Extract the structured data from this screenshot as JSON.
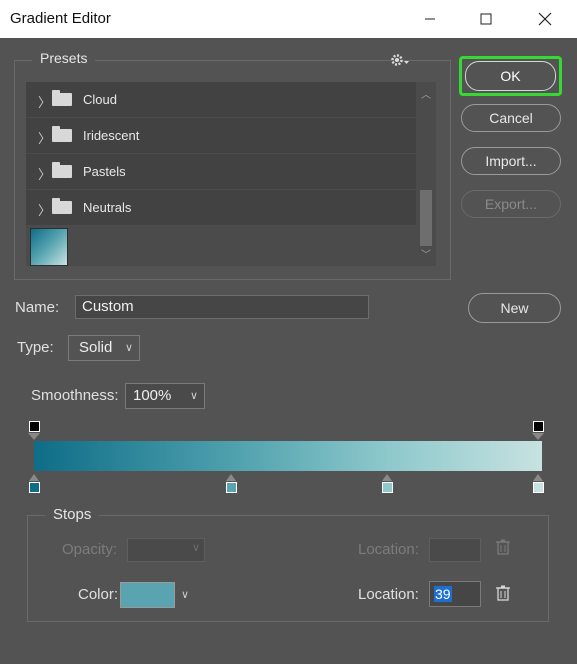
{
  "window": {
    "title": "Gradient Editor",
    "controls": [
      "minimize-icon",
      "maximize-icon",
      "close-icon"
    ]
  },
  "presets": {
    "legend": "Presets",
    "gear_icon": "gear-icon",
    "folders": [
      {
        "label": "Cloud"
      },
      {
        "label": "Iridescent"
      },
      {
        "label": "Pastels"
      },
      {
        "label": "Neutrals"
      }
    ]
  },
  "buttons": {
    "ok": "OK",
    "cancel": "Cancel",
    "import": "Import...",
    "export": "Export...",
    "new": "New"
  },
  "name": {
    "label": "Name:",
    "value": "Custom"
  },
  "type": {
    "label": "Type:",
    "value": "Solid"
  },
  "smoothness": {
    "label": "Smoothness:",
    "value": "100%"
  },
  "gradient": {
    "colors": [
      "#0e6d87",
      "#4fa0ad",
      "#8ec9cc",
      "#c7e2e0"
    ],
    "color_stop_locations": [
      0,
      39,
      70,
      100
    ]
  },
  "stops": {
    "legend": "Stops",
    "opacity_label": "Opacity:",
    "opacity_location_label": "Location:",
    "color_label": "Color:",
    "color_value": "#5aa3b0",
    "color_location_label": "Location:",
    "color_location_value": "39"
  },
  "colors": {
    "background": "#535353",
    "ok_highlight": "#36d836",
    "selection": "#1e6fd0"
  }
}
